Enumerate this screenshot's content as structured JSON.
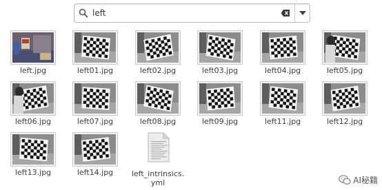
{
  "search": {
    "query": "left",
    "icon": "search-icon",
    "clear_icon": "clear-icon",
    "dropdown_icon": "chevron-down-icon"
  },
  "files": [
    {
      "name": "left.jpg",
      "kind": "photo"
    },
    {
      "name": "left01.jpg",
      "kind": "checker"
    },
    {
      "name": "left02.jpg",
      "kind": "checker"
    },
    {
      "name": "left03.jpg",
      "kind": "checker"
    },
    {
      "name": "left04.jpg",
      "kind": "checker"
    },
    {
      "name": "left05.jpg",
      "kind": "checker"
    },
    {
      "name": "left06.jpg",
      "kind": "checker"
    },
    {
      "name": "left07.jpg",
      "kind": "checker"
    },
    {
      "name": "left08.jpg",
      "kind": "checker"
    },
    {
      "name": "left09.jpg",
      "kind": "checker"
    },
    {
      "name": "left11.jpg",
      "kind": "checker"
    },
    {
      "name": "left12.jpg",
      "kind": "checker"
    },
    {
      "name": "left13.jpg",
      "kind": "checker"
    },
    {
      "name": "left14.jpg",
      "kind": "checker"
    },
    {
      "name": "left_intrinsics.\nyml",
      "kind": "document"
    }
  ],
  "watermark": {
    "text": "AI秘籍",
    "icon": "wechat-icon"
  },
  "colors": {
    "label": "#3d3d3d",
    "border": "#c9c9c9",
    "checker_dark": "#111111",
    "checker_light": "#f4f4f4"
  }
}
